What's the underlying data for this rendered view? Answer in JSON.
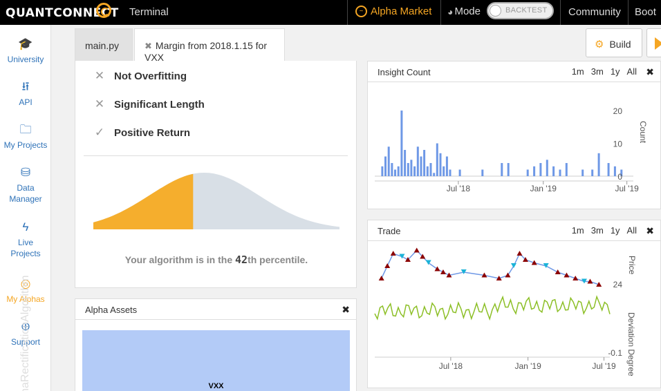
{
  "topbar": {
    "logo_text": "QUANTCONNECT",
    "terminal": "Terminal",
    "alpha_market": "Alpha Market",
    "mode": "Mode",
    "toggle_label": "BACKTEST",
    "community": "Community",
    "boot": "Boot"
  },
  "sidebar": {
    "items": [
      {
        "label": "University",
        "icon": "graduation-cap-icon"
      },
      {
        "label": "API",
        "icon": "usb-icon"
      },
      {
        "label": "My Projects",
        "icon": "folder-icon"
      },
      {
        "label": "Data Manager",
        "icon": "database-icon"
      },
      {
        "label": "Live Projects",
        "icon": "bolt-icon"
      },
      {
        "label": "My Alphas",
        "icon": "alpha-icon"
      },
      {
        "label": "Support",
        "icon": "lifebuoy-icon"
      }
    ],
    "watermark": "EmaRectificationAlgorithm"
  },
  "tabs": {
    "main": "main.py",
    "margin": "Margin from 2018.1.15 for VXX",
    "build": "Build"
  },
  "report": {
    "checks": [
      {
        "label": "Not Overfitting",
        "state": "fail"
      },
      {
        "label": "Significant Length",
        "state": "fail"
      },
      {
        "label": "Positive Return",
        "state": "pass"
      }
    ],
    "percentile_prefix": "Your algorithm is in the ",
    "percentile_value": "42",
    "percentile_suffix": "th percentile.",
    "percentile": 42,
    "colors": {
      "filled": "#f5ae2d",
      "rest": "#d8dfe6"
    }
  },
  "assets": {
    "title": "Alpha Assets",
    "asset": "VXX",
    "close": "✖"
  },
  "insight": {
    "title": "Insight Count",
    "ranges": [
      "1m",
      "3m",
      "1y",
      "All"
    ],
    "close": "✖"
  },
  "trade": {
    "title": "Trade",
    "ranges": [
      "1m",
      "3m",
      "1y",
      "All"
    ],
    "close": "✖"
  },
  "chart_data": [
    {
      "type": "bar",
      "title": "Insight Count",
      "ylabel": "Count",
      "ylim": [
        0,
        20
      ],
      "yticks": [
        "20",
        "10",
        "0"
      ],
      "xticks": [
        "Jul '18",
        "Jan '19",
        "Jul '19"
      ],
      "color": "#6e98e6",
      "x": [
        "2018-01-15",
        "2018-01-22",
        "2018-01-29",
        "2018-02-05",
        "2018-02-12",
        "2018-02-19",
        "2018-02-26",
        "2018-03-05",
        "2018-03-12",
        "2018-03-19",
        "2018-03-26",
        "2018-04-02",
        "2018-04-09",
        "2018-04-16",
        "2018-04-23",
        "2018-04-30",
        "2018-05-07",
        "2018-05-14",
        "2018-05-21",
        "2018-05-28",
        "2018-06-04",
        "2018-06-11",
        "2018-07-02",
        "2018-08-20",
        "2018-10-01",
        "2018-10-15",
        "2018-11-26",
        "2018-12-10",
        "2018-12-24",
        "2019-01-07",
        "2019-01-21",
        "2019-02-04",
        "2019-02-18",
        "2019-03-25",
        "2019-04-15",
        "2019-04-29",
        "2019-05-20",
        "2019-06-03",
        "2019-06-17"
      ],
      "values": [
        3,
        6,
        9,
        4,
        2,
        3,
        20,
        8,
        4,
        5,
        3,
        9,
        6,
        8,
        3,
        4,
        1,
        10,
        7,
        3,
        6,
        2,
        2,
        2,
        4,
        4,
        2,
        3,
        4,
        5,
        3,
        2,
        4,
        2,
        2,
        7,
        4,
        3,
        2
      ]
    },
    {
      "type": "scatter",
      "title": "Trade",
      "ylabel": "Price",
      "ytick": "24",
      "xticks": [
        "Jul '18",
        "Jan '19",
        "Jul '19"
      ],
      "line_color": "#6e98e6",
      "long_color": "#8b0000",
      "short_color": "#1bb3d8",
      "x": [
        "2018-01-17",
        "2018-01-31",
        "2018-02-14",
        "2018-03-07",
        "2018-03-21",
        "2018-04-11",
        "2018-04-25",
        "2018-05-09",
        "2018-05-30",
        "2018-06-13",
        "2018-06-27",
        "2018-08-01",
        "2018-09-19",
        "2018-10-24",
        "2018-11-14",
        "2018-11-28",
        "2018-12-12",
        "2018-12-26",
        "2019-01-16",
        "2019-02-13",
        "2019-03-13",
        "2019-04-03",
        "2019-04-24",
        "2019-05-15",
        "2019-05-29",
        "2019-06-19"
      ],
      "values": [
        26,
        30,
        34,
        33,
        32,
        35,
        33,
        31,
        29,
        28,
        27,
        28,
        27,
        26,
        27,
        30,
        34,
        32,
        31,
        30,
        28,
        27,
        26,
        25,
        25,
        24
      ]
    },
    {
      "type": "line",
      "title": "Deviation Degree",
      "ylabel": "Deviation Degree",
      "ytick": "-0.1",
      "xticks": [
        "Jul '18",
        "Jan '19",
        "Jul '19"
      ],
      "color": "#8cbf26"
    }
  ]
}
